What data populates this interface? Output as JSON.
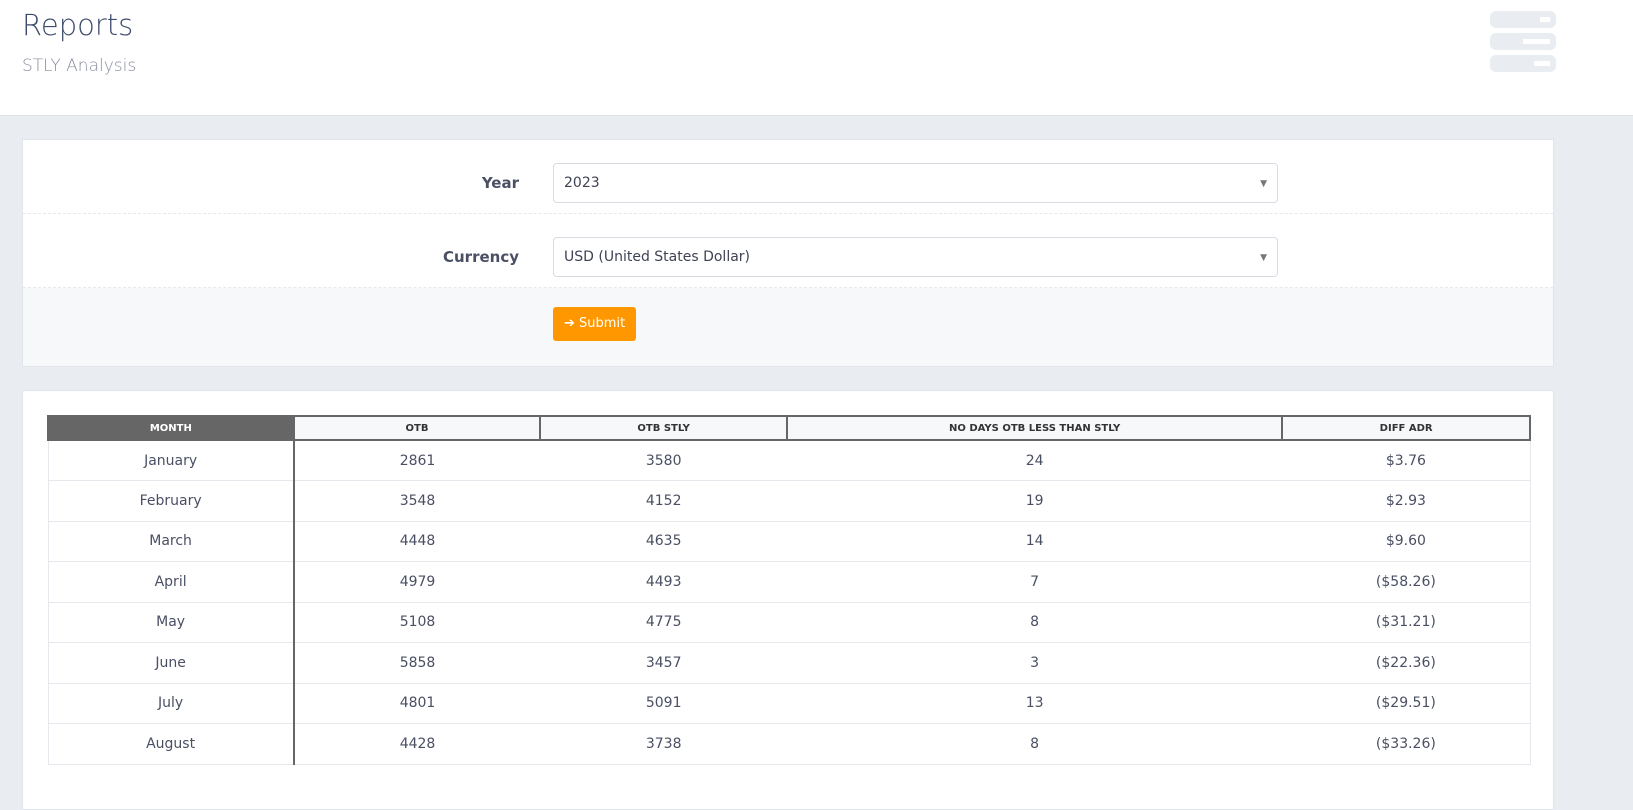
{
  "header": {
    "title": "Reports",
    "subtitle": "STLY Analysis"
  },
  "form": {
    "year_label": "Year",
    "year_value": "2023",
    "currency_label": "Currency",
    "currency_value": "USD (United States Dollar)",
    "submit_label": "Submit"
  },
  "table": {
    "headers": [
      "MONTH",
      "OTB",
      "OTB STLY",
      "NO DAYS OTB LESS THAN STLY",
      "DIFF ADR"
    ],
    "rows": [
      [
        "January",
        "2861",
        "3580",
        "24",
        "$3.76"
      ],
      [
        "February",
        "3548",
        "4152",
        "19",
        "$2.93"
      ],
      [
        "March",
        "4448",
        "4635",
        "14",
        "$9.60"
      ],
      [
        "April",
        "4979",
        "4493",
        "7",
        "($58.26)"
      ],
      [
        "May",
        "5108",
        "4775",
        "8",
        "($31.21)"
      ],
      [
        "June",
        "5858",
        "3457",
        "3",
        "($22.36)"
      ],
      [
        "July",
        "4801",
        "5091",
        "13",
        "($29.51)"
      ],
      [
        "August",
        "4428",
        "3738",
        "8",
        "($33.26)"
      ]
    ]
  }
}
